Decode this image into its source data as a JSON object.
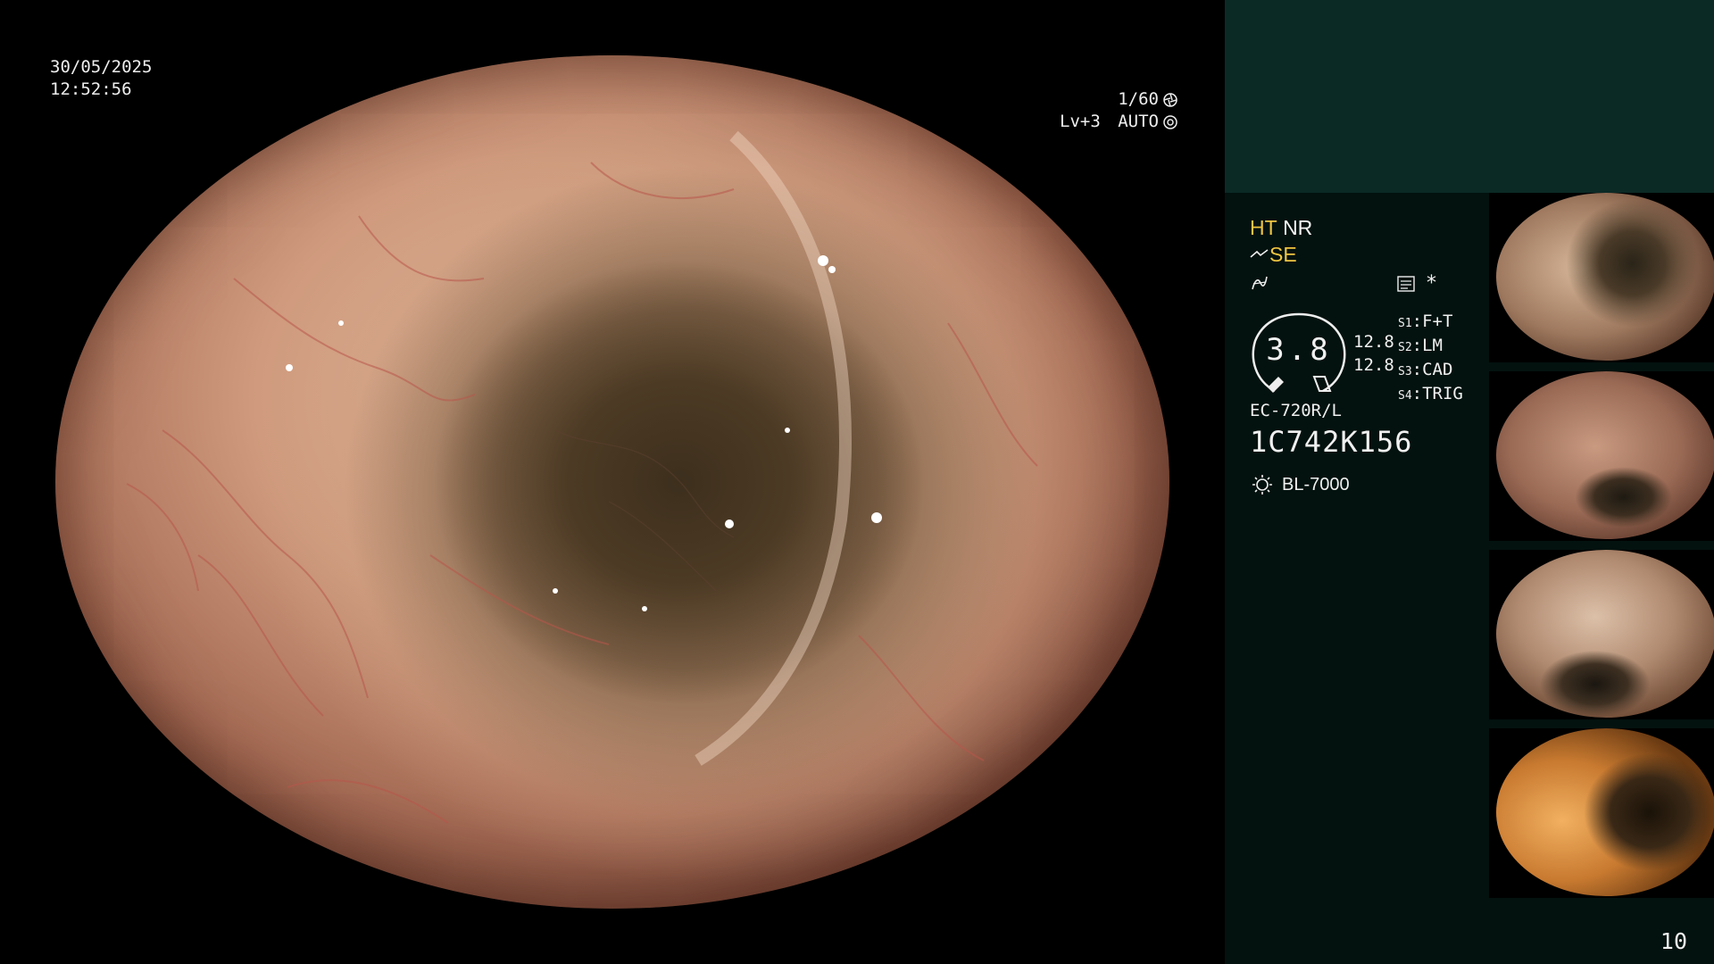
{
  "overlay": {
    "date": "30/05/2025",
    "time": "12:52:56",
    "shutter": "1/60",
    "level": "Lv+3",
    "iris_mode": "AUTO"
  },
  "panel": {
    "ht": "HT",
    "nr": "NR",
    "se": "SE",
    "gauge_value": "3.8",
    "reading_1": "12.8",
    "reading_2": "12.8",
    "settings": [
      {
        "key": "S1",
        "value": "F+T"
      },
      {
        "key": "S2",
        "value": "LM"
      },
      {
        "key": "S3",
        "value": "CAD"
      },
      {
        "key": "S4",
        "value": "TRIG"
      }
    ],
    "asterisk": "*",
    "scope_model": "EC-720R/L",
    "scope_serial": "1C742K156",
    "light_source": "BL-7000",
    "frame_number": "10"
  },
  "colors": {
    "accent_yellow": "#f0c542",
    "panel_top": "#0b2a26",
    "panel_bg": "#03120f"
  },
  "icons": [
    "shutter-icon",
    "iris-icon",
    "enhancement-icon",
    "filter-icon",
    "memo-icon",
    "lamp-icon"
  ]
}
